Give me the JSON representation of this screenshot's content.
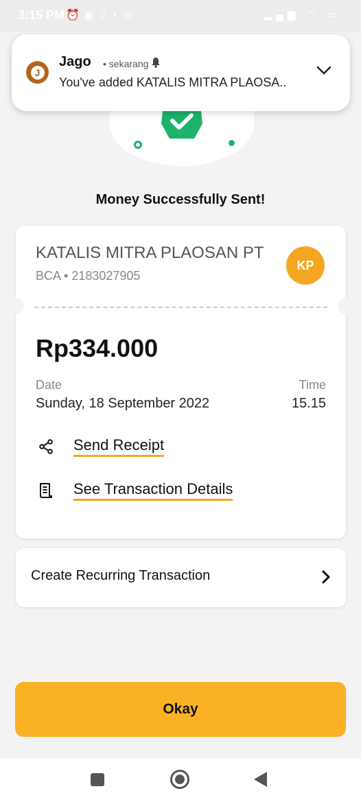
{
  "status_bar": {
    "time": "3:15 PM",
    "battery": "38"
  },
  "notification": {
    "app_name": "Jago",
    "time": "sekarang",
    "message": "You've added KATALIS MITRA PLAOSA.."
  },
  "page": {
    "title": "Money Successfully Sent!"
  },
  "receipt": {
    "recipient_name": "KATALIS MITRA PLAOSAN PT",
    "bank": "BCA",
    "account_number": "2183027905",
    "bank_line": "BCA • 2183027905",
    "avatar_initials": "KP",
    "amount": "Rp334.000",
    "date_label": "Date",
    "date_value": "Sunday, 18 September 2022",
    "time_label": "Time",
    "time_value": "15.15",
    "actions": [
      {
        "label": "Send Receipt",
        "icon": "share-icon"
      },
      {
        "label": "See Transaction Details",
        "icon": "receipt-icon"
      }
    ]
  },
  "recurring": {
    "label": "Create Recurring Transaction"
  },
  "footer": {
    "okay_label": "Okay"
  },
  "colors": {
    "accent": "#fbb126",
    "success": "#1db36b",
    "avatar": "#f5a623",
    "background": "#f3f3f3"
  }
}
